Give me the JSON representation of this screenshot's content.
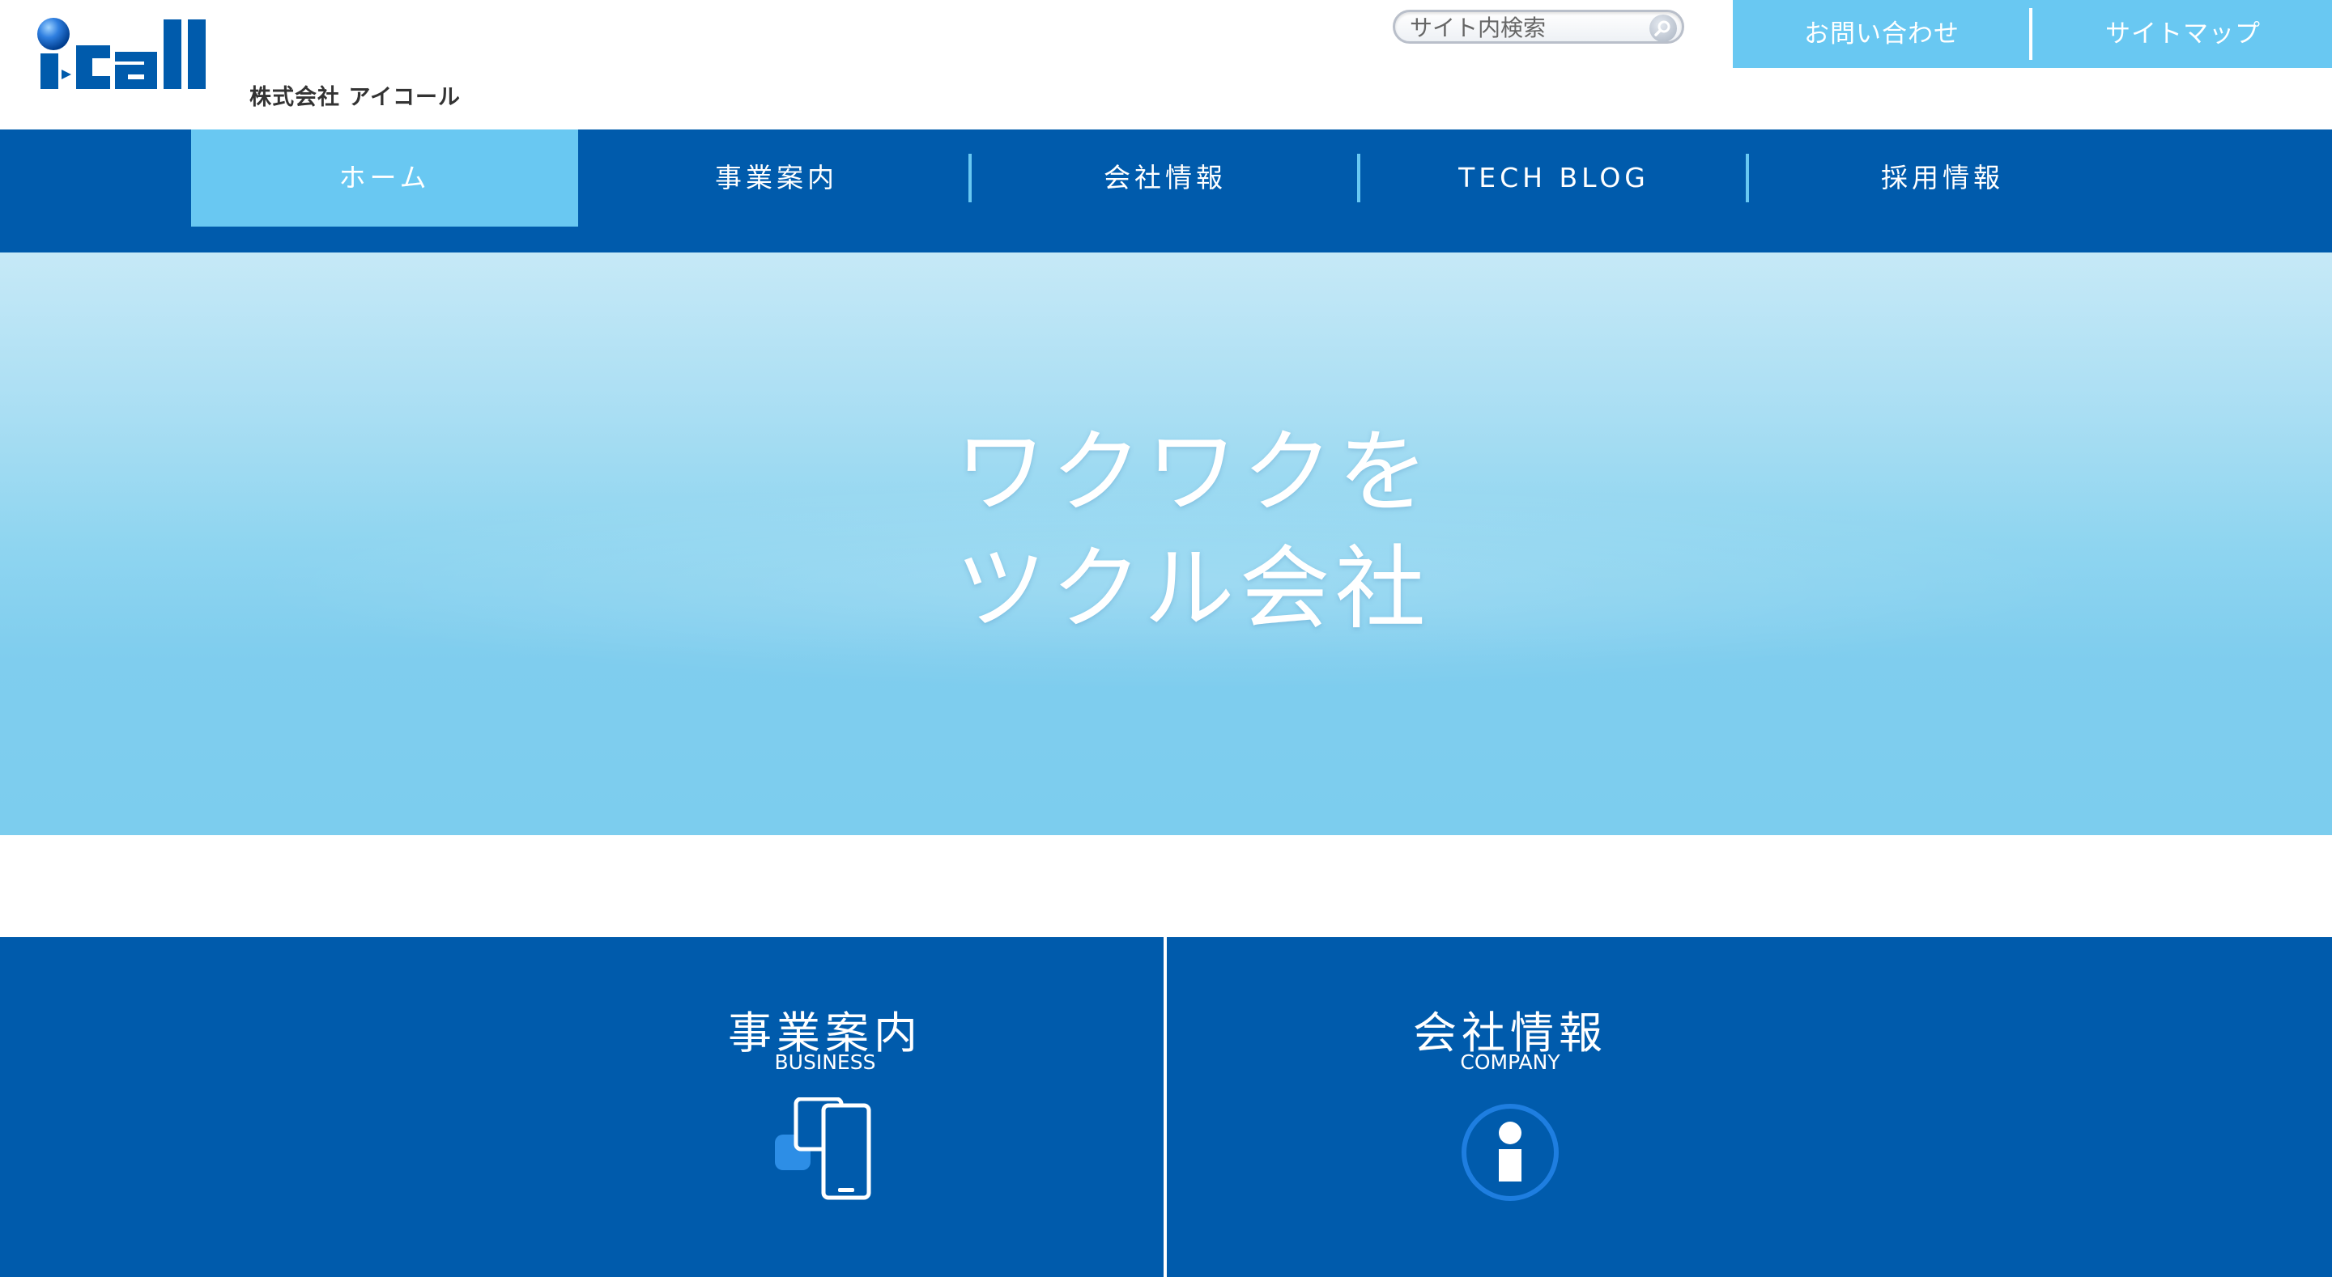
{
  "brand": {
    "logo_text": "i-Call",
    "company_name": "株式会社 アイコール",
    "primary_color": "#005bac",
    "accent_color": "#69c8f2"
  },
  "search": {
    "placeholder": "サイト内検索",
    "button_icon": "search-icon"
  },
  "utility_nav": {
    "contact_label": "お問い合わせ",
    "sitemap_label": "サイトマップ"
  },
  "global_nav": {
    "items": [
      {
        "label": "ホーム",
        "active": true
      },
      {
        "label": "事業案内",
        "active": false
      },
      {
        "label": "会社情報",
        "active": false
      },
      {
        "label": "TECH BLOG",
        "active": false
      },
      {
        "label": "採用情報",
        "active": false
      }
    ]
  },
  "hero": {
    "line1": "ワクワクを",
    "line2": "ツクル会社"
  },
  "features": [
    {
      "title": "事業案内",
      "subtitle": "BUSINESS",
      "icon": "devices-icon"
    },
    {
      "title": "会社情報",
      "subtitle": "COMPANY",
      "icon": "info-icon"
    }
  ]
}
